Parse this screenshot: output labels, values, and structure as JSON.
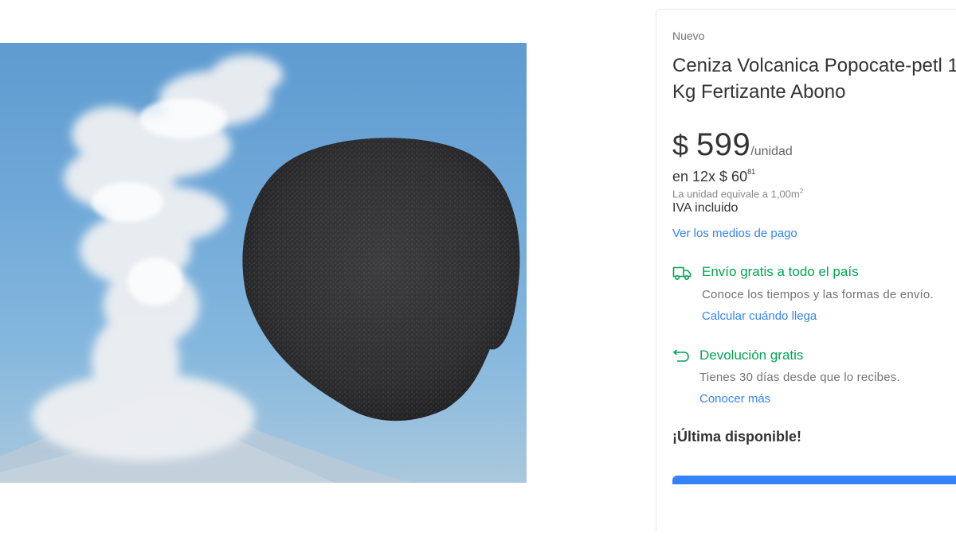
{
  "product": {
    "image_alt": "",
    "condition": "Nuevo",
    "title": "Ceniza Volcanica Popocate-petl 1 Kg Fertizante Abono",
    "price": {
      "currency": "$",
      "amount": "599",
      "unit": "/unidad"
    },
    "installments": {
      "prefix": "en 12x $ 60",
      "cents": "81"
    },
    "unit_equivalence": {
      "text": "La unidad equivale a 1,00m",
      "sup": "2"
    },
    "tax_note": "IVA incluido",
    "payment_link": "Ver los medios de pago"
  },
  "shipping": {
    "icon": "truck-icon",
    "title": "Envío gratis a todo el país",
    "description": "Conoce los tiempos y las formas de envío.",
    "link": "Calcular cuándo llega"
  },
  "returns": {
    "icon": "return-arrow-icon",
    "title": "Devolución gratis",
    "description": "Tienes 30 días desde que lo recibes.",
    "link": "Conocer más"
  },
  "stock": {
    "text": "¡Última disponible!"
  },
  "colors": {
    "link_blue": "#3483fa",
    "success_green": "#00a650",
    "text_dark": "#333333",
    "text_muted": "#737373"
  }
}
